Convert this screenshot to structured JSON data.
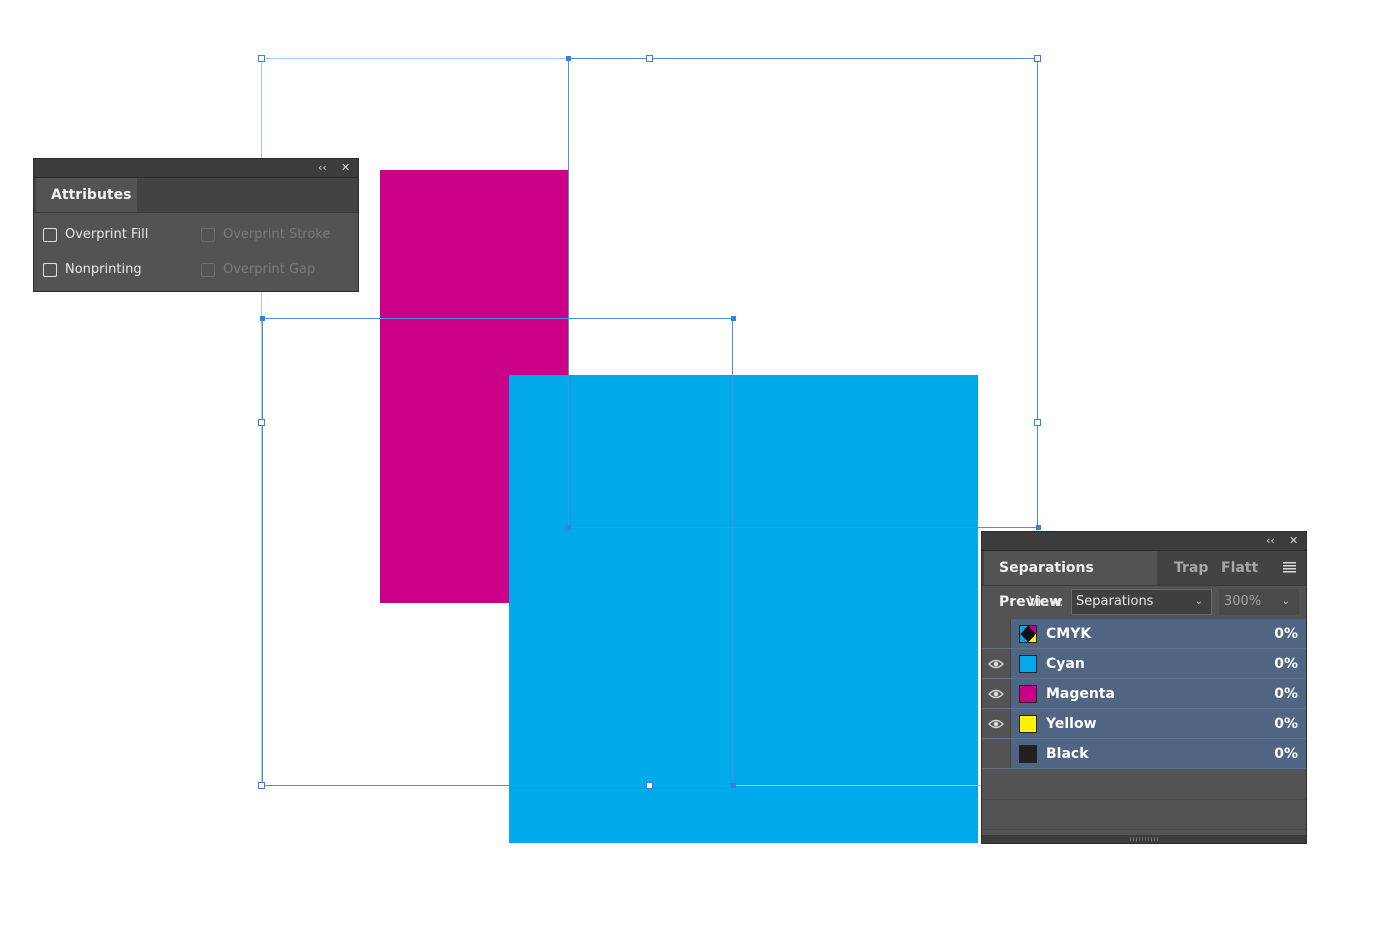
{
  "attributes_panel": {
    "tab_label": "Attributes",
    "collapse_glyph": "‹‹",
    "close_glyph": "✕",
    "options": [
      {
        "label": "Overprint Fill",
        "checked": false,
        "enabled": true
      },
      {
        "label": "Overprint Stroke",
        "checked": false,
        "enabled": false
      },
      {
        "label": "Nonprinting",
        "checked": false,
        "enabled": true
      },
      {
        "label": "Overprint Gap",
        "checked": false,
        "enabled": false
      }
    ]
  },
  "separations_panel": {
    "tabs": [
      "Separations Preview",
      "Trap",
      "Flatte"
    ],
    "menu_icon": "hamburger-menu-icon",
    "collapse_glyph": "‹‹",
    "close_glyph": "✕",
    "view_label": "View:",
    "view_value": "Separations",
    "coverage_value": "300%",
    "separations": [
      {
        "name": "CMYK",
        "percent": "0%",
        "visible": false,
        "color": "cmyk"
      },
      {
        "name": "Cyan",
        "percent": "0%",
        "visible": true,
        "color": "#00a8ec"
      },
      {
        "name": "Magenta",
        "percent": "0%",
        "visible": true,
        "color": "#cc0088"
      },
      {
        "name": "Yellow",
        "percent": "0%",
        "visible": true,
        "color": "#fff200"
      },
      {
        "name": "Black",
        "percent": "0%",
        "visible": false,
        "color": "#231f20"
      }
    ]
  },
  "artwork": {
    "magenta_color": "#cc0088",
    "cyan_color": "#00aaea",
    "selection_color": "#4a8ee6"
  }
}
